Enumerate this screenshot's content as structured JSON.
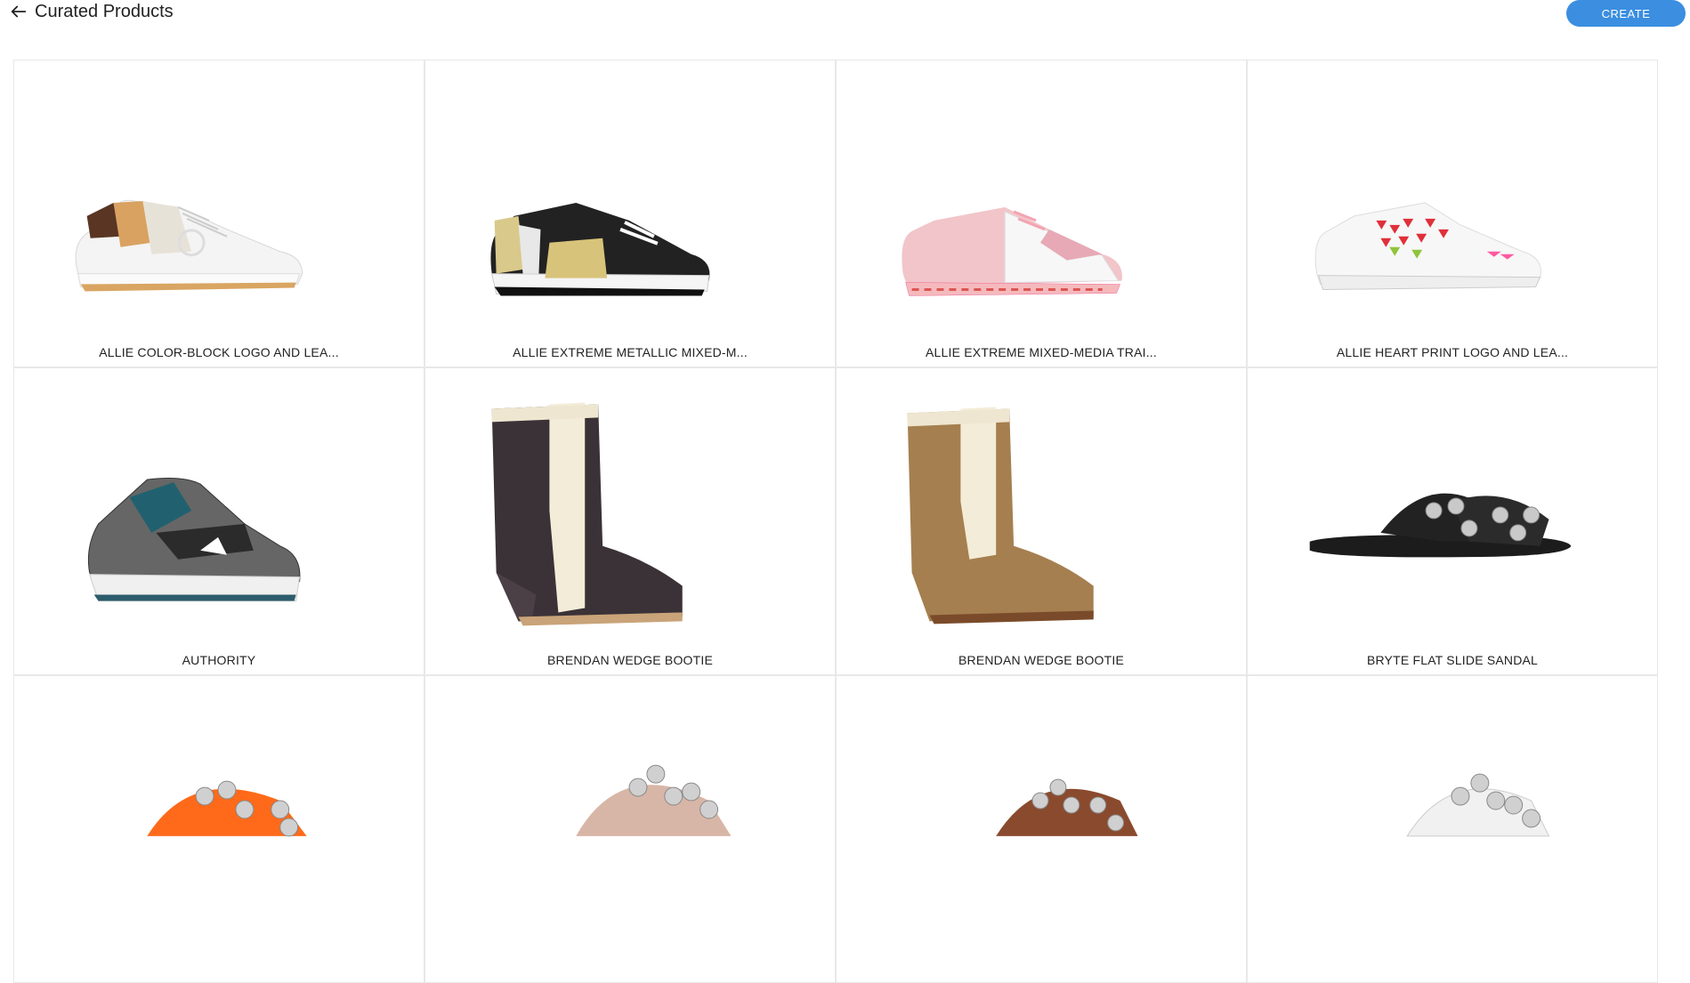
{
  "header": {
    "title": "Curated Products",
    "create_label": "CREATE",
    "accent_color": "#3b8ee0"
  },
  "products": [
    {
      "name": "ALLIE COLOR-BLOCK LOGO AND LEA...",
      "image": "white-sneaker-logo"
    },
    {
      "name": "ALLIE EXTREME METALLIC MIXED-M...",
      "image": "black-gold-sneaker"
    },
    {
      "name": "ALLIE EXTREME MIXED-MEDIA TRAI...",
      "image": "pink-sneaker"
    },
    {
      "name": "ALLIE HEART PRINT LOGO AND LEA...",
      "image": "heart-print-sneaker"
    },
    {
      "name": "AUTHORITY",
      "image": "teal-high-top-sneaker"
    },
    {
      "name": "BRENDAN WEDGE BOOTIE",
      "image": "dark-wedge-bootie"
    },
    {
      "name": "BRENDAN WEDGE BOOTIE",
      "image": "tan-wedge-bootie"
    },
    {
      "name": "BRYTE FLAT SLIDE SANDAL",
      "image": "black-studded-slide"
    },
    {
      "name": "",
      "image": "orange-studded-slide"
    },
    {
      "name": "",
      "image": "nude-studded-slide"
    },
    {
      "name": "",
      "image": "brown-studded-slide"
    },
    {
      "name": "",
      "image": "clear-studded-slide"
    }
  ]
}
